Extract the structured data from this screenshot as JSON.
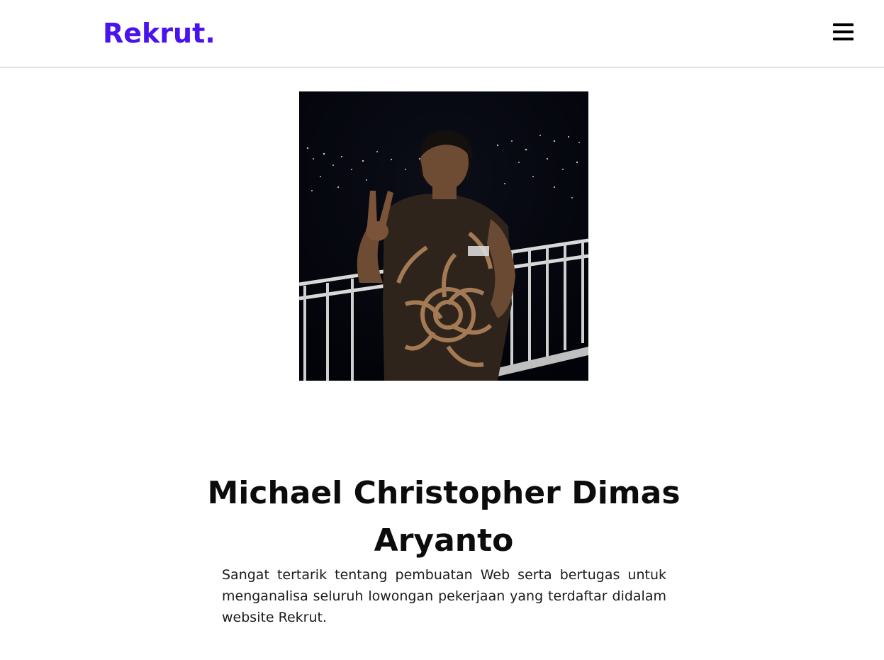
{
  "brand": {
    "name": "Rekrut.",
    "color": "#4a12ee"
  },
  "nav": {
    "menu_icon": "hamburger-menu-icon"
  },
  "profile": {
    "photo": "profile-photo",
    "name": "Michael Christopher Dimas Aryanto",
    "bio": "Sangat tertarik tentang pembuatan Web serta bertugas untuk menganalisa seluruh lowongan pekerjaan yang terdaftar didalam website Rekrut."
  }
}
